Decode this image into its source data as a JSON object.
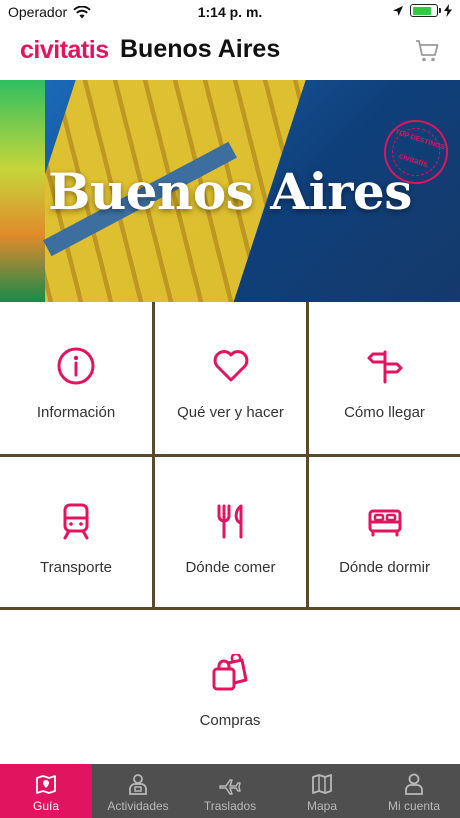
{
  "status_bar": {
    "carrier": "Operador",
    "time": "1:14 p. m.",
    "battery_level": 0.8
  },
  "header": {
    "brand": "civitatis",
    "city": "Buenos Aires",
    "cart_icon": "cart-icon"
  },
  "hero": {
    "title": "Buenos Aires",
    "stamp_top": "TOP DESTINOS",
    "stamp_bottom": "civitatis"
  },
  "tiles": [
    {
      "label": "Información",
      "icon": "info-icon"
    },
    {
      "label": "Qué ver y hacer",
      "icon": "heart-icon"
    },
    {
      "label": "Cómo llegar",
      "icon": "signpost-icon"
    },
    {
      "label": "Transporte",
      "icon": "train-icon"
    },
    {
      "label": "Dónde comer",
      "icon": "fork-knife-icon"
    },
    {
      "label": "Dónde dormir",
      "icon": "bed-icon"
    },
    {
      "label": "Compras",
      "icon": "shopping-bags-icon"
    }
  ],
  "tab_bar": {
    "items": [
      {
        "label": "Guía",
        "icon": "map-pin-icon",
        "active": true
      },
      {
        "label": "Actividades",
        "icon": "guide-person-icon",
        "active": false
      },
      {
        "label": "Traslados",
        "icon": "plane-icon",
        "active": false
      },
      {
        "label": "Mapa",
        "icon": "map-icon",
        "active": false
      },
      {
        "label": "Mi cuenta",
        "icon": "user-icon",
        "active": false
      }
    ]
  },
  "colors": {
    "accent": "#e0145f",
    "tab_bar_bg": "#4f4f4f",
    "tab_inactive": "#b9b9b9"
  }
}
